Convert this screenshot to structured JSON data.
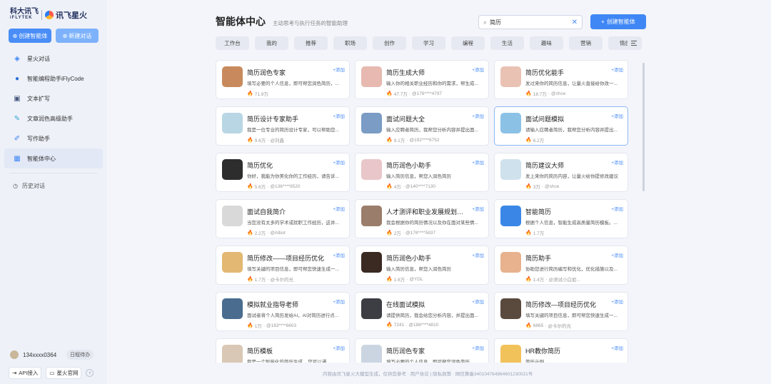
{
  "brand": {
    "logo_top": "科大讯飞",
    "logo_bottom": "iFLYTEK",
    "product": "讯飞星火"
  },
  "sidebar": {
    "create_agent": "创建智能体",
    "new_chat": "新建对话",
    "items": [
      {
        "label": "星火对话",
        "icon": "spark-icon"
      },
      {
        "label": "智能编程助手iFlyCode",
        "icon": "code-icon"
      },
      {
        "label": "文本扩写",
        "icon": "text-icon"
      },
      {
        "label": "文章润色高级助手",
        "icon": "pen-icon"
      },
      {
        "label": "写作助手",
        "icon": "write-icon"
      },
      {
        "label": "智能体中心",
        "icon": "agent-center-icon"
      }
    ],
    "history": "历史对话",
    "user": "134xxxx0364",
    "schedule": "日程待办",
    "api": "API接入",
    "website": "星火官网"
  },
  "header": {
    "title": "智能体中心",
    "subtitle": "主动思考与执行任务的智能助理",
    "search_value": "简历",
    "create_button": "创建智能体"
  },
  "tabs": [
    "工作台",
    "我的",
    "推荐",
    "职场",
    "创作",
    "学习",
    "编程",
    "生活",
    "趣味",
    "营销",
    "情感"
  ],
  "add_label": "添加",
  "cards": [
    {
      "title": "简历润色专家",
      "desc": "填写必要的个人信息，即可帮您润色简历，...",
      "count": "71.9万",
      "author": "",
      "color": "#c88a5c"
    },
    {
      "title": "简历生成大师",
      "desc": "输入你的相关职业经历和你的需求，帮生成...",
      "count": "47.7万",
      "author": "@176****4797",
      "color": "#e7b9b0"
    },
    {
      "title": "简历优化能手",
      "desc": "发过来你的简历信息，让量火直接给你改一...",
      "count": "18.7万",
      "author": "@zhce",
      "color": "#e9c2b4"
    },
    {
      "title": "简历设计专家助手",
      "desc": "我是一位专业的简历设计专家，可以帮助您...",
      "count": "9.6万",
      "author": "@刘鑫",
      "color": "#b9d6e4"
    },
    {
      "title": "面试问题大全",
      "desc": "输入应聘者简历，我帮您分析内容并提出面...",
      "count": "9.1万",
      "author": "@192****6752",
      "color": "#7a9cc5"
    },
    {
      "title": "面试问题模拟",
      "desc": "请输入应聘者简历，我帮您分析内容并提出...",
      "count": "6.2万",
      "author": "",
      "color": "#8cc1e6"
    },
    {
      "title": "简历优化",
      "desc": "你好，我能为你美化你的工作经历，请告诉...",
      "count": "5.6万",
      "author": "@136****9520",
      "color": "#2d2d2d"
    },
    {
      "title": "简历润色小助手",
      "desc": "输入简历信息，帮您入润色简历",
      "count": "4万",
      "author": "@140****7130",
      "color": "#e9c6c9"
    },
    {
      "title": "简历建议大师",
      "desc": "发上来你的简历内容，让量火给你提修改建议",
      "count": "3万",
      "author": "@shce",
      "color": "#cfe1ec"
    },
    {
      "title": "面试自我简介",
      "desc": "当您没有太多的学术或就职工作经历，这并...",
      "count": "2.2万",
      "author": "@Albot",
      "color": "#d9d9d9"
    },
    {
      "title": "人才测评和职业发展规划专家",
      "desc": "我会根据你的简历情况以及你在面对某些情...",
      "count": "2万",
      "author": "@178****5837",
      "color": "#9a7d6a"
    },
    {
      "title": "智能简历",
      "desc": "根据个人信息，智能生成高质量简历模板。...",
      "count": "1.7万",
      "author": "",
      "color": "#3a86e6"
    },
    {
      "title": "简历修改——项目经历优化",
      "desc": "填写关键的项目信息，即可帮您快速生成一...",
      "count": "1.7万",
      "author": "@卡尔的光",
      "color": "#e2b872"
    },
    {
      "title": "简历润色小助手",
      "desc": "输入简历信息，帮您入润色简历",
      "count": "1.6万",
      "author": "@YDL",
      "color": "#3b2a22"
    },
    {
      "title": "简历助手",
      "desc": "协助您进行简历编写和优化，优化措施以及...",
      "count": "1.4万",
      "author": "@测试小白如...",
      "color": "#e7b28d"
    },
    {
      "title": "模拟就业指导老师",
      "desc": "面试者将个人简历发给AI，AI对简历进行点...",
      "count": "1万",
      "author": "@183****6603",
      "color": "#4a6c8f"
    },
    {
      "title": "在线面试模拟",
      "desc": "请提供简历，我会给您分析内容，并提出面...",
      "count": "7241",
      "author": "@186****4810",
      "color": "#3d3d44"
    },
    {
      "title": "简历修改—项目经历优化",
      "desc": "填写关键的项目信息，即可帮您快速生成一...",
      "count": "6865",
      "author": "@卡尔的光",
      "color": "#5a4a3e"
    },
    {
      "title": "简历模板",
      "desc": "我是一个智能化的简历生成... 您可以通...",
      "count": "",
      "author": "",
      "color": "#d9c8b5"
    },
    {
      "title": "简历润色专家",
      "desc": "填写必要的个人信息，即可帮您润色简历",
      "count": "",
      "author": "",
      "color": "#cbd5e2"
    },
    {
      "title": "HR教你简历",
      "desc": "简历示例",
      "count": "",
      "author": "",
      "color": "#f2c25a"
    }
  ],
  "footer": "内容由讯飞星火大模型生成，仅供您参考 · 用户协议 | 隐私政策 · 网信算备340104764864601230021号"
}
